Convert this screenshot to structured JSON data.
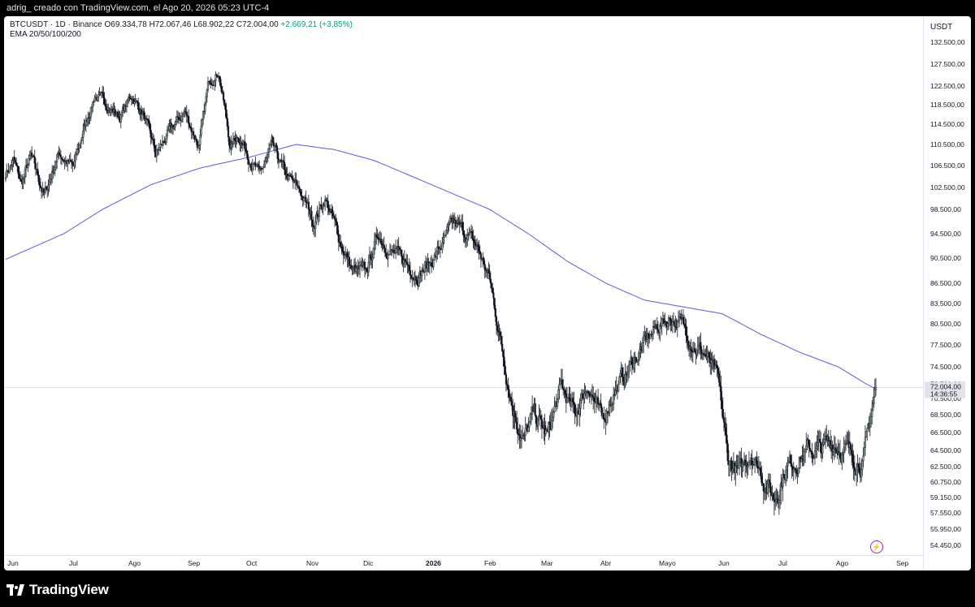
{
  "header": {
    "caption": "adrig_ creado con TradingView.com, el Ago 20, 2026 05:23 UTC-4"
  },
  "legend": {
    "symbol": "BTCUSDT · 1D · Binance",
    "open": "O69.334,78",
    "high": "H72.067,46",
    "low": "L68.902,22",
    "close": "C72.004,00",
    "change": "+2.669,21 (+3,85%)",
    "indicator": "EMA 20/50/100/200"
  },
  "price_axis": {
    "currency": "USDT",
    "last_price": "72.004,00",
    "countdown": "14:36:55"
  },
  "footer": {
    "brand": "TradingView"
  },
  "colors": {
    "up": "#089981",
    "down": "#131722",
    "up_body": "#8fa697",
    "ema": "#5b5bd6",
    "last_price_bg": "#e0e3eb"
  },
  "icons": {
    "flash": "lightning-icon",
    "logo": "tradingview-logo-icon"
  },
  "chart_data": {
    "type": "candlestick",
    "symbol": "BTCUSDT",
    "interval": "1D",
    "ylim": [
      53500,
      133500
    ],
    "y_ticks": [
      "132.500,00",
      "127.500,00",
      "122.500,00",
      "118.500,00",
      "114.500,00",
      "110.500,00",
      "106.500,00",
      "102.500,00",
      "98.500,00",
      "94.500,00",
      "90.500,00",
      "86.500,00",
      "83.500,00",
      "80.500,00",
      "77.500,00",
      "74.500,00",
      "72.500,00",
      "70.500,00",
      "68.500,00",
      "66.500,00",
      "64.500,00",
      "62.500,00",
      "60.750,00",
      "59.150,00",
      "57.550,00",
      "55.950,00",
      "54.450,00"
    ],
    "x_ticks": [
      "Jun",
      "Jul",
      "Ago",
      "Sep",
      "Oct",
      "Nov",
      "Dic",
      "2026",
      "Feb",
      "Mar",
      "Abr",
      "Mayo",
      "Jun",
      "Jul",
      "Ago",
      "Sep"
    ],
    "x_ticks_bold": [
      "2026"
    ],
    "price_path": [
      [
        0,
        105200
      ],
      [
        8,
        107500
      ],
      [
        16,
        103000
      ],
      [
        26,
        108000
      ],
      [
        40,
        101000
      ],
      [
        55,
        109000
      ],
      [
        70,
        106000
      ],
      [
        80,
        113000
      ],
      [
        92,
        120500
      ],
      [
        105,
        118500
      ],
      [
        118,
        116000
      ],
      [
        130,
        120500
      ],
      [
        142,
        116500
      ],
      [
        155,
        108500
      ],
      [
        170,
        113000
      ],
      [
        185,
        117000
      ],
      [
        200,
        110000
      ],
      [
        210,
        123500
      ],
      [
        220,
        126000
      ],
      [
        232,
        110000
      ],
      [
        240,
        112500
      ],
      [
        254,
        107500
      ],
      [
        262,
        104500
      ],
      [
        275,
        110000
      ],
      [
        290,
        104500
      ],
      [
        305,
        101500
      ],
      [
        318,
        96500
      ],
      [
        330,
        100500
      ],
      [
        345,
        93500
      ],
      [
        358,
        88500
      ],
      [
        372,
        88000
      ],
      [
        385,
        94500
      ],
      [
        398,
        91500
      ],
      [
        412,
        90000
      ],
      [
        425,
        88000
      ],
      [
        438,
        89500
      ],
      [
        450,
        92500
      ],
      [
        462,
        96000
      ],
      [
        476,
        94500
      ],
      [
        488,
        92000
      ],
      [
        500,
        87000
      ],
      [
        512,
        77500
      ],
      [
        524,
        69500
      ],
      [
        535,
        65500
      ],
      [
        546,
        68500
      ],
      [
        560,
        66000
      ],
      [
        574,
        72000
      ],
      [
        588,
        68500
      ],
      [
        602,
        72500
      ],
      [
        616,
        67500
      ],
      [
        628,
        71500
      ],
      [
        640,
        73500
      ],
      [
        652,
        76000
      ],
      [
        664,
        78500
      ],
      [
        676,
        80500
      ],
      [
        688,
        81500
      ],
      [
        700,
        80000
      ],
      [
        712,
        77500
      ],
      [
        724,
        76000
      ],
      [
        736,
        72500
      ],
      [
        746,
        63500
      ],
      [
        758,
        61500
      ],
      [
        770,
        64500
      ],
      [
        782,
        61500
      ],
      [
        794,
        59000
      ],
      [
        806,
        62500
      ],
      [
        818,
        63500
      ],
      [
        830,
        64500
      ],
      [
        842,
        64500
      ],
      [
        854,
        65500
      ],
      [
        866,
        64500
      ],
      [
        878,
        63500
      ],
      [
        886,
        63000
      ],
      [
        894,
        68500
      ],
      [
        899,
        72004
      ]
    ],
    "ema_200": [
      [
        0,
        90300
      ],
      [
        60,
        94500
      ],
      [
        100,
        98500
      ],
      [
        150,
        103000
      ],
      [
        200,
        106000
      ],
      [
        250,
        108000
      ],
      [
        300,
        110500
      ],
      [
        340,
        109500
      ],
      [
        380,
        107500
      ],
      [
        420,
        104500
      ],
      [
        460,
        101500
      ],
      [
        500,
        98500
      ],
      [
        540,
        94500
      ],
      [
        580,
        90000
      ],
      [
        620,
        86500
      ],
      [
        660,
        84000
      ],
      [
        700,
        83000
      ],
      [
        740,
        82000
      ],
      [
        780,
        79000
      ],
      [
        820,
        76500
      ],
      [
        860,
        74500
      ],
      [
        899,
        71800
      ]
    ],
    "last_price": 72004.0
  }
}
